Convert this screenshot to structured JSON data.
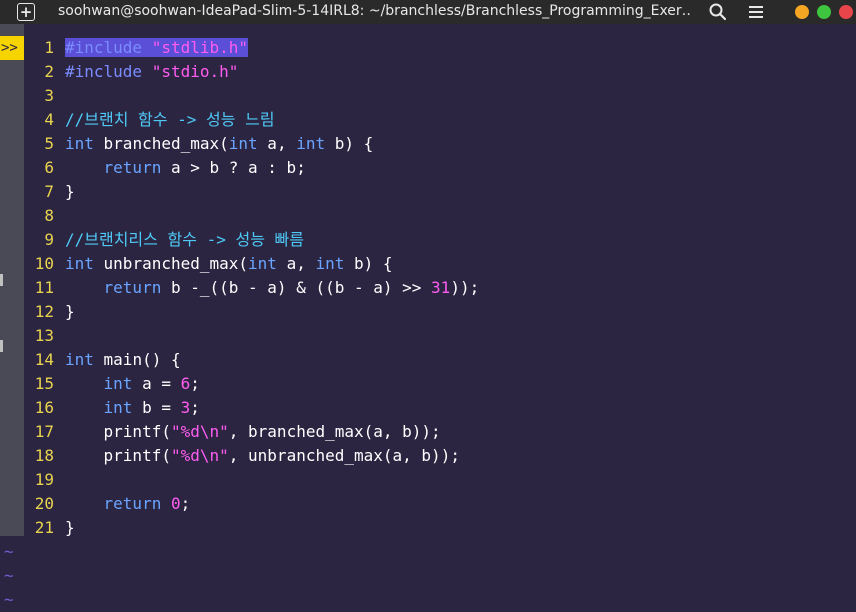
{
  "window": {
    "title": "soohwan@soohwan-IdeaPad-Slim-5-14IRL8: ~/branchless/Branchless_Programming_Exer…",
    "new_tab_glyph": "+",
    "colors": {
      "minimize": "#f5a623",
      "maximize": "#3fc43f",
      "close": "#e8454a"
    }
  },
  "editor": {
    "sign_marker": ">>",
    "tilde": "~",
    "colors": {
      "background": "#2c2542",
      "line_number": "#e8d44d",
      "preprocessor": "#7b8cff",
      "string": "#ff5cf0",
      "keyword": "#6aa4ff",
      "comment": "#4ec9f5",
      "number": "#ff5cf0",
      "selection": "#5a4fd6"
    },
    "lines": [
      {
        "n": "1",
        "t": [
          [
            "pp hl",
            "#include "
          ],
          [
            "str hl",
            "\"stdlib.h\""
          ]
        ]
      },
      {
        "n": "2",
        "t": [
          [
            "pp",
            "#include "
          ],
          [
            "str",
            "\"stdio.h\""
          ]
        ]
      },
      {
        "n": "3",
        "t": []
      },
      {
        "n": "4",
        "t": [
          [
            "cm",
            "//브랜치 함수 -> 성능 느림"
          ]
        ]
      },
      {
        "n": "5",
        "t": [
          [
            "kw",
            "int"
          ],
          [
            "",
            " branched_max("
          ],
          [
            "kw",
            "int"
          ],
          [
            "",
            " a, "
          ],
          [
            "kw",
            "int"
          ],
          [
            "",
            " b) {"
          ]
        ]
      },
      {
        "n": "6",
        "t": [
          [
            "",
            "    "
          ],
          [
            "kw",
            "return"
          ],
          [
            "",
            " a > b ? a : b;"
          ]
        ]
      },
      {
        "n": "7",
        "t": [
          [
            "",
            "}"
          ]
        ]
      },
      {
        "n": "8",
        "t": []
      },
      {
        "n": "9",
        "t": [
          [
            "cm",
            "//브랜치리스 함수 -> 성능 빠름"
          ]
        ]
      },
      {
        "n": "10",
        "t": [
          [
            "kw",
            "int"
          ],
          [
            "",
            " unbranched_max("
          ],
          [
            "kw",
            "int"
          ],
          [
            "",
            " a, "
          ],
          [
            "kw",
            "int"
          ],
          [
            "",
            " b) {"
          ]
        ]
      },
      {
        "n": "11",
        "t": [
          [
            "",
            "    "
          ],
          [
            "kw",
            "return"
          ],
          [
            "",
            " b -_((b - a) & ((b - a) >> "
          ],
          [
            "num",
            "31"
          ],
          [
            "",
            "));"
          ]
        ]
      },
      {
        "n": "12",
        "t": [
          [
            "",
            "}"
          ]
        ]
      },
      {
        "n": "13",
        "t": []
      },
      {
        "n": "14",
        "t": [
          [
            "kw",
            "int"
          ],
          [
            "",
            " main() {"
          ]
        ]
      },
      {
        "n": "15",
        "t": [
          [
            "",
            "    "
          ],
          [
            "kw",
            "int"
          ],
          [
            "",
            " a = "
          ],
          [
            "num",
            "6"
          ],
          [
            "",
            ";"
          ]
        ]
      },
      {
        "n": "16",
        "t": [
          [
            "",
            "    "
          ],
          [
            "kw",
            "int"
          ],
          [
            "",
            " b = "
          ],
          [
            "num",
            "3"
          ],
          [
            "",
            ";"
          ]
        ]
      },
      {
        "n": "17",
        "t": [
          [
            "",
            "    printf("
          ],
          [
            "str",
            "\"%d\\n\""
          ],
          [
            "",
            ", branched_max(a, b));"
          ]
        ]
      },
      {
        "n": "18",
        "t": [
          [
            "",
            "    printf("
          ],
          [
            "str",
            "\"%d\\n\""
          ],
          [
            "",
            ", unbranched_max(a, b));"
          ]
        ]
      },
      {
        "n": "19",
        "t": []
      },
      {
        "n": "20",
        "t": [
          [
            "",
            "    "
          ],
          [
            "kw",
            "return"
          ],
          [
            "",
            " "
          ],
          [
            "num",
            "0"
          ],
          [
            "",
            ";"
          ]
        ]
      },
      {
        "n": "21",
        "t": [
          [
            "",
            "}"
          ]
        ]
      }
    ],
    "tilde_count": 3
  }
}
